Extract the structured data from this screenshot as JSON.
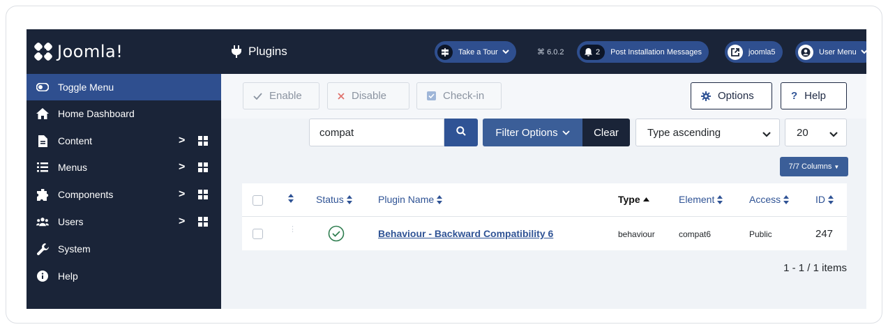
{
  "brand": {
    "name": "Joomla!",
    "logo_icon": "joomla-logo-icon"
  },
  "sidebar": {
    "items": [
      {
        "label": "Toggle Menu",
        "icon": "toggle-icon",
        "active": true
      },
      {
        "label": "Home Dashboard",
        "icon": "home-icon"
      },
      {
        "label": "Content",
        "icon": "file-icon",
        "has_submenu": true
      },
      {
        "label": "Menus",
        "icon": "list-icon",
        "has_submenu": true
      },
      {
        "label": "Components",
        "icon": "puzzle-icon",
        "has_submenu": true
      },
      {
        "label": "Users",
        "icon": "users-icon",
        "has_submenu": true
      },
      {
        "label": "System",
        "icon": "wrench-icon"
      },
      {
        "label": "Help",
        "icon": "info-icon"
      }
    ]
  },
  "header": {
    "title": "Plugins",
    "tour_label": "Take a Tour",
    "version": "6.0.2",
    "notifications_count": "2",
    "post_install_label": "Post Installation Messages",
    "site_label": "joomla5",
    "user_menu_label": "User Menu"
  },
  "toolbar": {
    "enable_label": "Enable",
    "disable_label": "Disable",
    "checkin_label": "Check-in",
    "options_label": "Options",
    "help_label": "Help"
  },
  "filters": {
    "search_value": "compat",
    "filter_options_label": "Filter Options",
    "clear_label": "Clear",
    "sort_value": "Type ascending",
    "limit_value": "20",
    "columns_label": "7/7 Columns"
  },
  "table": {
    "headers": {
      "status": "Status",
      "plugin_name": "Plugin Name",
      "type": "Type",
      "element": "Element",
      "access": "Access",
      "id": "ID"
    },
    "rows": [
      {
        "plugin_name": "Behaviour - Backward Compatibility 6",
        "type": "behaviour",
        "element": "compat6",
        "access": "Public",
        "id": "247",
        "status": "enabled"
      }
    ]
  },
  "pagination": {
    "summary": "1 - 1 / 1 items"
  },
  "colors": {
    "sidebar_bg": "#1a2438",
    "active_item": "#2f4f8f",
    "primary": "#2f5395",
    "content_bg": "#f0f3f7",
    "success": "#2e7d4f"
  }
}
